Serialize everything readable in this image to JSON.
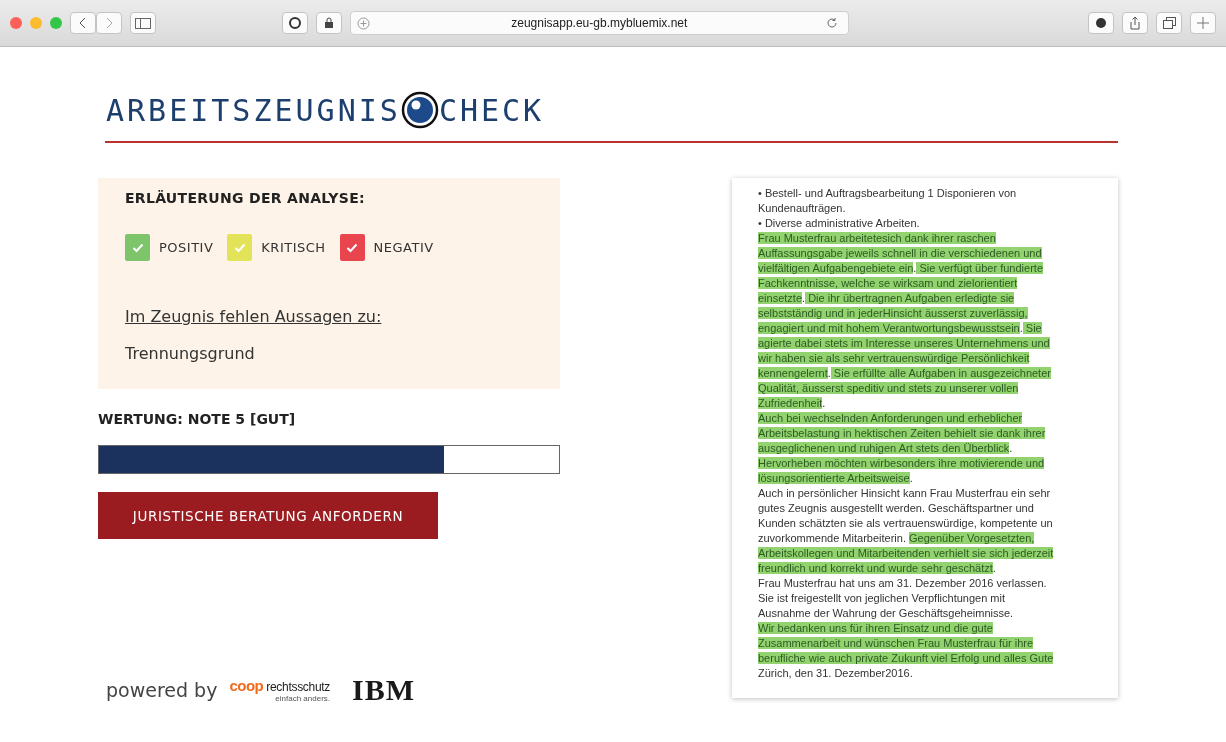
{
  "browser": {
    "url": "zeugnisapp.eu-gb.mybluemix.net"
  },
  "logo": {
    "part_1": "ARBEITSZEUGNIS",
    "part_2": "CHECK"
  },
  "legend": {
    "title": "ERLÄUTERUNG DER ANALYSE:",
    "items": [
      {
        "label": "POSITIV",
        "color": "#7dc46a",
        "checked": true
      },
      {
        "label": "KRITISCH",
        "color": "#e3e35a",
        "checked": true
      },
      {
        "label": "NEGATIV",
        "color": "#e8454f",
        "checked": true
      }
    ],
    "missing_heading": "Im Zeugnis fehlen Aussagen zu:",
    "missing_items": [
      "Trennungsgrund"
    ]
  },
  "rating": {
    "label": "WERTUNG: NOTE 5 [GUT]",
    "level": 0.75
  },
  "action_button": "JURISTISCHE BERATUNG ANFORDERN",
  "footer": {
    "powered_by": "powered by",
    "partner_name": "coop",
    "partner_word": "rechtsschutz",
    "partner_tagline": "einfach anders.",
    "tech_partner": "IBM"
  },
  "document": {
    "lines": [
      {
        "segments": [
          {
            "text": "• Bestell- und Auftragsbearbeitung 1 Disponieren von",
            "highlighted": false
          }
        ]
      },
      {
        "segments": [
          {
            "text": "Kundenaufträgen.",
            "highlighted": false
          }
        ]
      },
      {
        "segments": [
          {
            "text": "• Diverse administrative Arbeiten.",
            "highlighted": false
          }
        ]
      },
      {
        "segments": [
          {
            "text": "Frau Musterfrau arbeitetesich dank ihrer raschen",
            "highlighted": true
          }
        ]
      },
      {
        "segments": [
          {
            "text": "Auffassungsgabe jeweils schnell in die verschiedenen und",
            "highlighted": true
          }
        ]
      },
      {
        "segments": [
          {
            "text": "vielfältigen Aufgabengebiete ein",
            "highlighted": true
          },
          {
            "text": ".",
            "highlighted": false
          },
          {
            "text": " Sie verfügt über fundierte",
            "highlighted": true
          }
        ]
      },
      {
        "segments": [
          {
            "text": "Fachkenntnisse, welche se wirksam und zielorientiert",
            "highlighted": true
          }
        ]
      },
      {
        "segments": [
          {
            "text": "einsetzte",
            "highlighted": true
          },
          {
            "text": ".",
            "highlighted": false
          },
          {
            "text": " Die ihr übertragnen Aufgaben erledigte sie",
            "highlighted": true
          }
        ]
      },
      {
        "segments": [
          {
            "text": "selbstständig und in jederHinsicht äusserst zuverlässig,",
            "highlighted": true
          }
        ]
      },
      {
        "segments": [
          {
            "text": "engagiert und mit hohem Verantwortungsbewusstsein",
            "highlighted": true
          },
          {
            "text": ".",
            "highlighted": false
          },
          {
            "text": " Sie",
            "highlighted": true
          }
        ]
      },
      {
        "segments": [
          {
            "text": "agierte dabei stets im Interesse unseres Unternehmens und",
            "highlighted": true
          }
        ]
      },
      {
        "segments": [
          {
            "text": "wir haben sie als sehr vertrauenswürdige Persönlichkeit",
            "highlighted": true
          }
        ]
      },
      {
        "segments": [
          {
            "text": "kennengelernt",
            "highlighted": true
          },
          {
            "text": ".",
            "highlighted": false
          },
          {
            "text": " Sie erfüllte alle Aufgaben in ausgezeichneter",
            "highlighted": true
          }
        ]
      },
      {
        "segments": [
          {
            "text": "Qualität, äusserst speditiv und stets zu unserer vollen",
            "highlighted": true
          }
        ]
      },
      {
        "segments": [
          {
            "text": "Zufriedenheit",
            "highlighted": true
          },
          {
            "text": ".",
            "highlighted": false
          }
        ]
      },
      {
        "segments": [
          {
            "text": "Auch bei wechselnden Anforderungen und erheblicher",
            "highlighted": true
          }
        ]
      },
      {
        "segments": [
          {
            "text": "Arbeitsbelastung in hektischen Zeiten behielt sie dank ihrer",
            "highlighted": true
          }
        ]
      },
      {
        "segments": [
          {
            "text": "ausgeglichenen und ruhigen Art stets den Überblick",
            "highlighted": true
          },
          {
            "text": ".",
            "highlighted": false
          }
        ]
      },
      {
        "segments": [
          {
            "text": "Hervorheben möchten wirbesonders ihre motivierende und",
            "highlighted": true
          }
        ]
      },
      {
        "segments": [
          {
            "text": "lösungsorientierte Arbeitsweise",
            "highlighted": true
          },
          {
            "text": ".",
            "highlighted": false
          }
        ]
      },
      {
        "segments": [
          {
            "text": "Auch in persönlicher Hinsicht kann Frau Musterfrau ein sehr",
            "highlighted": false
          }
        ]
      },
      {
        "segments": [
          {
            "text": "gutes Zeugnis ausgestellt werden. Geschäftspartner und",
            "highlighted": false
          }
        ]
      },
      {
        "segments": [
          {
            "text": "Kunden schätzten sie als vertrauenswürdige, kompetente un",
            "highlighted": false
          }
        ]
      },
      {
        "segments": [
          {
            "text": "zuvorkommende Mitarbeiterin. ",
            "highlighted": false
          },
          {
            "text": "Gegenüber Vorgesetzten,",
            "highlighted": true
          }
        ]
      },
      {
        "segments": [
          {
            "text": "Arbeitskollegen und Mitarbeitenden verhielt sie sich jederzeit",
            "highlighted": true
          }
        ]
      },
      {
        "segments": [
          {
            "text": "freundlich und korrekt und wurde sehr geschätzt",
            "highlighted": true
          },
          {
            "text": ".",
            "highlighted": false
          }
        ]
      },
      {
        "segments": [
          {
            "text": "Frau Musterfrau hat uns am 31. Dezember 2016 verlassen.",
            "highlighted": false
          }
        ]
      },
      {
        "segments": [
          {
            "text": "Sie ist freigestellt von jeglichen Verpflichtungen mit",
            "highlighted": false
          }
        ]
      },
      {
        "segments": [
          {
            "text": "Ausnahme der Wahrung der Geschäftsgeheimnisse.",
            "highlighted": false
          }
        ]
      },
      {
        "segments": [
          {
            "text": "Wir bedanken uns für ihren Einsatz und die gute",
            "highlighted": true
          }
        ]
      },
      {
        "segments": [
          {
            "text": "Zusammenarbeit und wünschen Frau Musterfrau für ihre",
            "highlighted": true
          }
        ]
      },
      {
        "segments": [
          {
            "text": "berufliche wie auch private Zukunft viel Erfolg und alles Gute",
            "highlighted": true
          }
        ]
      },
      {
        "segments": [
          {
            "text": "Zürich, den 31. Dezember2016.",
            "highlighted": false
          }
        ]
      }
    ]
  }
}
